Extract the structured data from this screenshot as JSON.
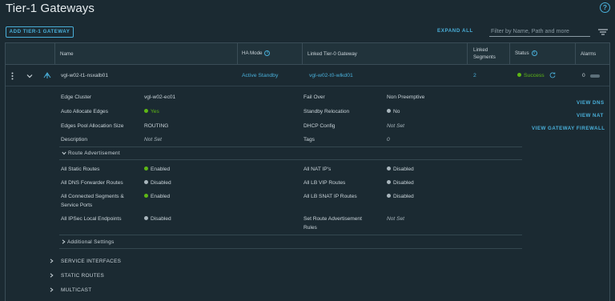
{
  "page": {
    "title": "Tier-1 Gateways",
    "help_glyph": "?"
  },
  "toolbar": {
    "add_button": "ADD TIER-1 GATEWAY",
    "expand_all": "EXPAND ALL",
    "filter_placeholder": "Filter by Name, Path and more"
  },
  "columns": {
    "name": "Name",
    "ha_mode": "HA Mode",
    "linked_tier0": "Linked Tier-0 Gateway",
    "linked_segments_1": "Linked",
    "linked_segments_2": "Segments",
    "status": "Status",
    "alarms": "Alarms"
  },
  "row": {
    "name": "vgl-w02-t1-nsxalb01",
    "ha_mode": "Active Standby",
    "linked_tier0": "vgl-w02-t0-wlkd01",
    "linked_segments": "2",
    "status": "Success",
    "alarms": "0"
  },
  "details": {
    "left": [
      {
        "label": "Edge Cluster",
        "value": "vgl-w02-ec01",
        "dot": ""
      },
      {
        "label": "Auto Allocate Edges",
        "value": "Yes",
        "dot": "green"
      },
      {
        "label": "Edges Pool Allocation Size",
        "value": "ROUTING",
        "dot": ""
      },
      {
        "label": "Description",
        "value": "Not Set",
        "dot": ""
      }
    ],
    "right": [
      {
        "label": "Fail Over",
        "value": "Non Preemptive",
        "dot": ""
      },
      {
        "label": "Standby Relocation",
        "value": "No",
        "dot": "gray"
      },
      {
        "label": "DHCP Config",
        "value": "Not Set",
        "dot": ""
      },
      {
        "label": "Tags",
        "value": "0",
        "dot": ""
      }
    ]
  },
  "side_links": {
    "view_dns": "VIEW DNS",
    "view_nat": "VIEW NAT",
    "view_firewall": "VIEW GATEWAY FIREWALL"
  },
  "route_advertisement": {
    "title": "Route Advertisement",
    "left": [
      {
        "label": "All Static Routes",
        "value": "Enabled",
        "dot": "green"
      },
      {
        "label": "All DNS Forwarder Routes",
        "value": "Disabled",
        "dot": "gray"
      },
      {
        "label_1": "All Connected Segments &",
        "label_2": "Service Ports",
        "value": "Enabled",
        "dot": "green"
      },
      {
        "label": "All IPSec Local Endpoints",
        "value": "Disabled",
        "dot": "gray"
      }
    ],
    "right": [
      {
        "label": "All NAT IP's",
        "value": "Disabled",
        "dot": "gray"
      },
      {
        "label": "All LB VIP Routes",
        "value": "Disabled",
        "dot": "gray"
      },
      {
        "label": "All LB SNAT IP Routes",
        "value": "Disabled",
        "dot": "gray"
      },
      {
        "label_1": "Set Route Advertisement",
        "label_2": "Rules",
        "value": "Not Set",
        "dot": ""
      }
    ]
  },
  "sections": {
    "additional_settings": "Additional Settings",
    "service_interfaces": "SERVICE INTERFACES",
    "static_routes": "STATIC ROUTES",
    "multicast": "MULTICAST"
  },
  "colors": {
    "accent": "#49afd9",
    "success": "#5eb715",
    "background": "#1b2a32"
  }
}
